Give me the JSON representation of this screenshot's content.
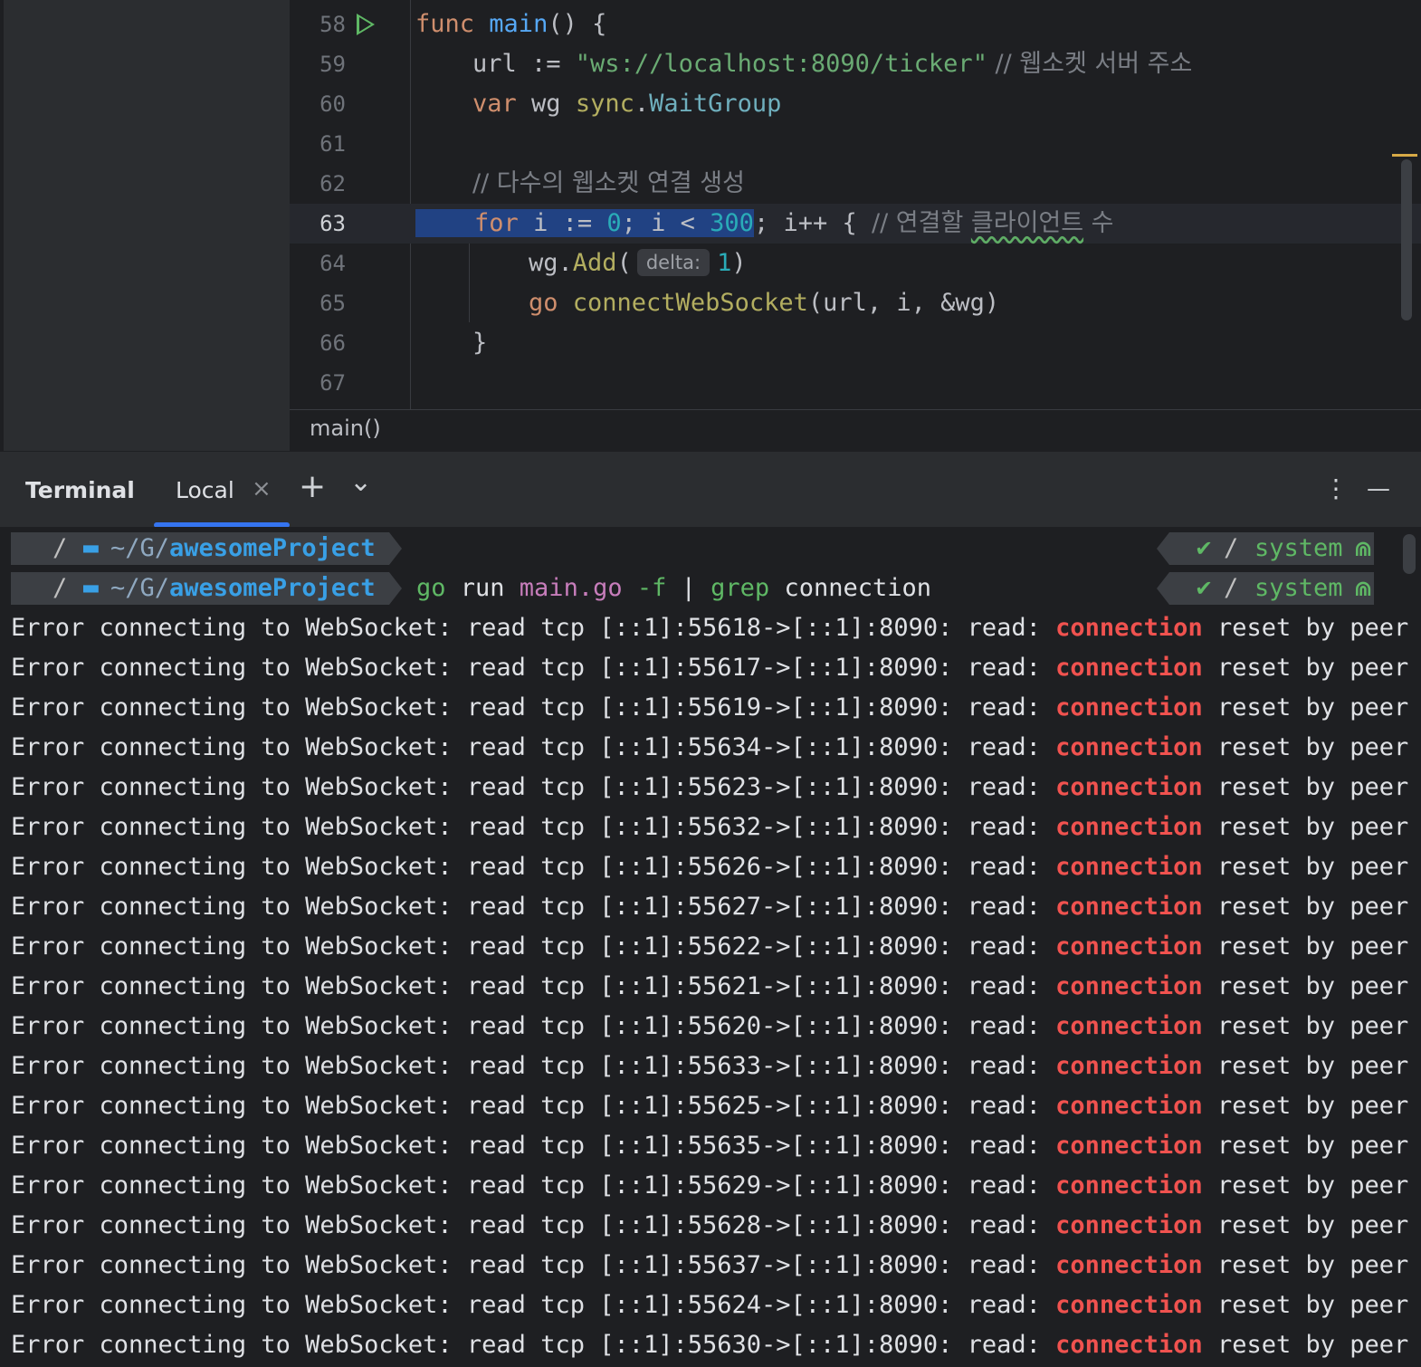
{
  "editor": {
    "lines": [
      {
        "num": "58"
      },
      {
        "num": "59"
      },
      {
        "num": "60"
      },
      {
        "num": "61"
      },
      {
        "num": "62"
      },
      {
        "num": "63"
      },
      {
        "num": "64"
      },
      {
        "num": "65"
      },
      {
        "num": "66"
      },
      {
        "num": "67"
      }
    ],
    "code": {
      "l58_kw": "func",
      "l58_fn": "main",
      "l58_rest": "() {",
      "l59_var": "url := ",
      "l59_str": "\"ws://localhost:8090/ticker\"",
      "l59_comment": " // 웹소켓 서버 주소",
      "l60_kw": "var",
      "l60_var": " wg ",
      "l60_pkg": "sync",
      "l60_dot": ".",
      "l60_type": "WaitGroup",
      "l62_comment": "// 다수의 웹소켓 연결 생성",
      "l63_kw": "for",
      "l63_a": " i := ",
      "l63_n0": "0",
      "l63_b": "; i < ",
      "l63_n300": "300",
      "l63_c": "; i++ { ",
      "l63_comment": "// 연결할 ",
      "l63_typo": "클라이언트",
      "l63_comment2": " 수",
      "l64_a": "wg.",
      "l64_call": "Add",
      "l64_paren": "(",
      "l64_hint": "delta:",
      "l64_n": "1",
      "l64_close": ")",
      "l65_kw": "go",
      "l65_call": " connectWebSocket",
      "l65_rest": "(url, i, &wg)",
      "l66": "}"
    },
    "breadcrumb": "main()"
  },
  "terminal": {
    "title": "Terminal",
    "tab_label": "Local",
    "tab_close": "×",
    "add_button": "+",
    "dropdown": "⌄",
    "more_button": "⋮",
    "minimize_button": "—",
    "prompt": {
      "apple": "",
      "slash": "/",
      "folder": "▬",
      "path_prefix": "~/G/",
      "path_dir": "awesomeProject",
      "status_check": "✔",
      "status_slash": "/",
      "status_env": "system",
      "status_icon": "⋒"
    },
    "command": {
      "go": "go",
      "run": " run ",
      "file": "main.go",
      "flag": " -f",
      "pipe": " | ",
      "grep": "grep",
      "arg": " connection"
    },
    "output_prefix": "Error connecting to WebSocket: read tcp [::1]:",
    "output_mid": "->[::1]:8090: read: ",
    "output_highlight": "connection",
    "output_suffix": " reset by peer",
    "ports": [
      "55618",
      "55617",
      "55619",
      "55634",
      "55623",
      "55632",
      "55626",
      "55627",
      "55622",
      "55621",
      "55620",
      "55633",
      "55625",
      "55635",
      "55629",
      "55628",
      "55637",
      "55624",
      "55630"
    ]
  },
  "colors": {
    "highlight": "#f0524f",
    "selection": "#214283",
    "accent": "#3574f0"
  }
}
